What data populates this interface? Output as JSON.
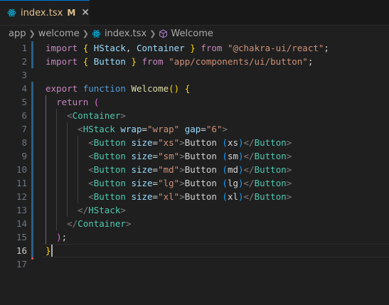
{
  "tab": {
    "filename": "index.tsx",
    "status": "M",
    "close": "✕"
  },
  "breadcrumb": [
    "app",
    "welcome",
    "index.tsx",
    "Welcome"
  ],
  "editor": {
    "line_numbers": [
      "1",
      "2",
      "3",
      "4",
      "5",
      "6",
      "7",
      "8",
      "9",
      "10",
      "11",
      "12",
      "13",
      "14",
      "15",
      "16",
      "17"
    ],
    "active_line": "16",
    "lines": [
      [
        [
          "import",
          "kw"
        ],
        [
          " ",
          ""
        ],
        [
          "{",
          "b1"
        ],
        [
          " ",
          ""
        ],
        [
          "HStack",
          "var"
        ],
        [
          ", ",
          ""
        ],
        [
          "Container",
          "var"
        ],
        [
          " ",
          ""
        ],
        [
          "}",
          "b1"
        ],
        [
          " ",
          ""
        ],
        [
          "from",
          "kw"
        ],
        [
          " ",
          ""
        ],
        [
          "\"@chakra-ui/react\"",
          "str"
        ],
        [
          ";",
          ""
        ]
      ],
      [
        [
          "import",
          "kw"
        ],
        [
          " ",
          ""
        ],
        [
          "{",
          "b1"
        ],
        [
          " ",
          ""
        ],
        [
          "Button",
          "var"
        ],
        [
          " ",
          ""
        ],
        [
          "}",
          "b1"
        ],
        [
          " ",
          ""
        ],
        [
          "from",
          "kw"
        ],
        [
          " ",
          ""
        ],
        [
          "\"app/components/ui/button\"",
          "str"
        ],
        [
          ";",
          ""
        ]
      ],
      [],
      [
        [
          "export",
          "kw"
        ],
        [
          " ",
          ""
        ],
        [
          "function",
          "st"
        ],
        [
          " ",
          ""
        ],
        [
          "Welcome",
          "fn"
        ],
        [
          "()",
          "b1"
        ],
        [
          " ",
          ""
        ],
        [
          "{",
          "b1"
        ]
      ],
      [
        [
          "  ",
          ""
        ],
        [
          "return",
          "kw"
        ],
        [
          " ",
          ""
        ],
        [
          "(",
          "b2"
        ]
      ],
      [
        [
          "    ",
          ""
        ],
        [
          "<",
          "ang"
        ],
        [
          "Container",
          "tag"
        ],
        [
          ">",
          "ang"
        ]
      ],
      [
        [
          "      ",
          ""
        ],
        [
          "<",
          "ang"
        ],
        [
          "HStack",
          "tag"
        ],
        [
          " ",
          ""
        ],
        [
          "wrap",
          "var"
        ],
        [
          "=",
          ""
        ],
        [
          "\"wrap\"",
          "str"
        ],
        [
          " ",
          ""
        ],
        [
          "gap",
          "var"
        ],
        [
          "=",
          ""
        ],
        [
          "\"6\"",
          "str"
        ],
        [
          ">",
          "ang"
        ]
      ],
      [
        [
          "        ",
          ""
        ],
        [
          "<",
          "ang"
        ],
        [
          "Button",
          "tag"
        ],
        [
          " ",
          ""
        ],
        [
          "size",
          "var"
        ],
        [
          "=",
          ""
        ],
        [
          "\"xs\"",
          "str"
        ],
        [
          ">",
          "ang"
        ],
        [
          "Button ",
          "txt"
        ],
        [
          "(",
          "b3"
        ],
        [
          "xs",
          "txt"
        ],
        [
          ")",
          "b3"
        ],
        [
          "</",
          "ang"
        ],
        [
          "Button",
          "tag"
        ],
        [
          ">",
          "ang"
        ]
      ],
      [
        [
          "        ",
          ""
        ],
        [
          "<",
          "ang"
        ],
        [
          "Button",
          "tag"
        ],
        [
          " ",
          ""
        ],
        [
          "size",
          "var"
        ],
        [
          "=",
          ""
        ],
        [
          "\"sm\"",
          "str"
        ],
        [
          ">",
          "ang"
        ],
        [
          "Button ",
          "txt"
        ],
        [
          "(",
          "b3"
        ],
        [
          "sm",
          "txt"
        ],
        [
          ")",
          "b3"
        ],
        [
          "</",
          "ang"
        ],
        [
          "Button",
          "tag"
        ],
        [
          ">",
          "ang"
        ]
      ],
      [
        [
          "        ",
          ""
        ],
        [
          "<",
          "ang"
        ],
        [
          "Button",
          "tag"
        ],
        [
          " ",
          ""
        ],
        [
          "size",
          "var"
        ],
        [
          "=",
          ""
        ],
        [
          "\"md\"",
          "str"
        ],
        [
          ">",
          "ang"
        ],
        [
          "Button ",
          "txt"
        ],
        [
          "(",
          "b3"
        ],
        [
          "md",
          "txt"
        ],
        [
          ")",
          "b3"
        ],
        [
          "</",
          "ang"
        ],
        [
          "Button",
          "tag"
        ],
        [
          ">",
          "ang"
        ]
      ],
      [
        [
          "        ",
          ""
        ],
        [
          "<",
          "ang"
        ],
        [
          "Button",
          "tag"
        ],
        [
          " ",
          ""
        ],
        [
          "size",
          "var"
        ],
        [
          "=",
          ""
        ],
        [
          "\"lg\"",
          "str"
        ],
        [
          ">",
          "ang"
        ],
        [
          "Button ",
          "txt"
        ],
        [
          "(",
          "b3"
        ],
        [
          "lg",
          "txt"
        ],
        [
          ")",
          "b3"
        ],
        [
          "</",
          "ang"
        ],
        [
          "Button",
          "tag"
        ],
        [
          ">",
          "ang"
        ]
      ],
      [
        [
          "        ",
          ""
        ],
        [
          "<",
          "ang"
        ],
        [
          "Button",
          "tag"
        ],
        [
          " ",
          ""
        ],
        [
          "size",
          "var"
        ],
        [
          "=",
          ""
        ],
        [
          "\"xl\"",
          "str"
        ],
        [
          ">",
          "ang"
        ],
        [
          "Button ",
          "txt"
        ],
        [
          "(",
          "b3"
        ],
        [
          "xl",
          "txt"
        ],
        [
          ")",
          "b3"
        ],
        [
          "</",
          "ang"
        ],
        [
          "Button",
          "tag"
        ],
        [
          ">",
          "ang"
        ]
      ],
      [
        [
          "      ",
          ""
        ],
        [
          "</",
          "ang"
        ],
        [
          "HStack",
          "tag"
        ],
        [
          ">",
          "ang"
        ]
      ],
      [
        [
          "    ",
          ""
        ],
        [
          "</",
          "ang"
        ],
        [
          "Container",
          "tag"
        ],
        [
          ">",
          "ang"
        ]
      ],
      [
        [
          "  ",
          ""
        ],
        [
          ")",
          "b2"
        ],
        [
          ";",
          ""
        ]
      ],
      [
        [
          "}",
          "b1"
        ]
      ],
      []
    ],
    "modified_lines": [
      "1",
      "2",
      "4",
      "5",
      "6",
      "7",
      "8",
      "9",
      "10",
      "11",
      "12",
      "13",
      "14",
      "15",
      "16"
    ],
    "deleted_marker_line": "17"
  },
  "colors": {
    "background": "#1f1f1f",
    "tab_accent": "#0078d4",
    "modified_text": "#e2c08d",
    "gutter_modified": "#2a5f86",
    "gutter_deleted": "#f14c4c"
  },
  "icons": {
    "file_icon": "react-tsx-icon",
    "symbol_icon": "method-cube-icon"
  }
}
